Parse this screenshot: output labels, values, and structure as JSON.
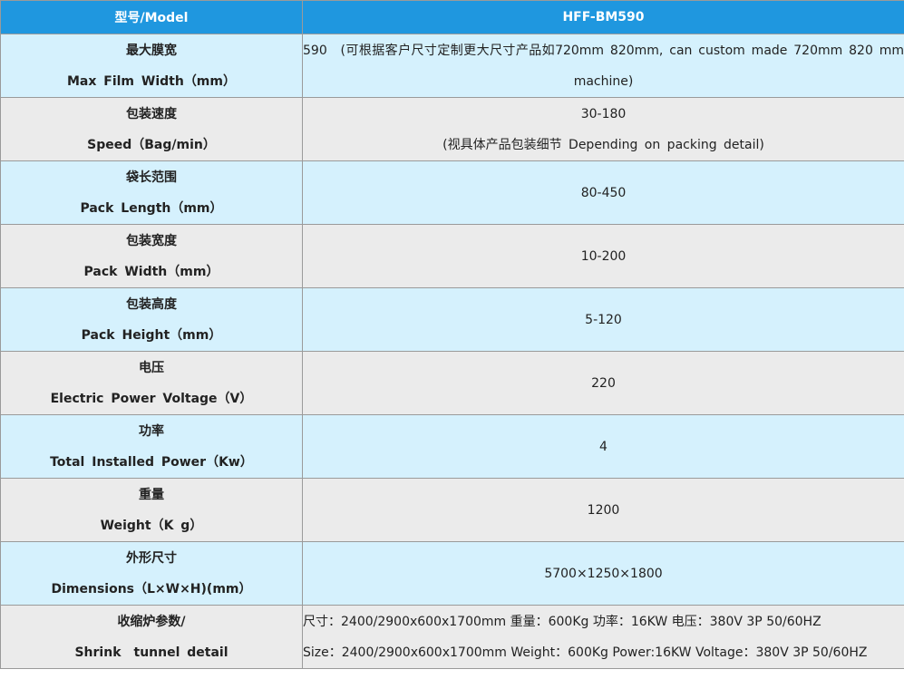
{
  "header": {
    "label": "型号/Model",
    "value": "HFF-BM590"
  },
  "rows": [
    {
      "label_cn": "最大膜宽",
      "label_en": "Max Film Width（mm）",
      "value_1": "590　(可根据客户尺寸定制更大尺寸产品如720mm 820mm, can custom made 720mm 820 mm machine)"
    },
    {
      "label_cn": "包装速度",
      "label_en": "Speed（Bag/min）",
      "value_1": "30-180",
      "value_2": "(视具体产品包装细节 Depending on packing detail)"
    },
    {
      "label_cn": "袋长范围",
      "label_en": "Pack Length（mm）",
      "value_1": "80-450"
    },
    {
      "label_cn": "包装宽度",
      "label_en": "Pack Width（mm）",
      "value_1": "10-200"
    },
    {
      "label_cn": "包装高度",
      "label_en": "Pack Height（mm）",
      "value_1": "5-120"
    },
    {
      "label_cn": "电压",
      "label_en": "Electric Power Voltage（V）",
      "value_1": "220"
    },
    {
      "label_cn": "功率",
      "label_en": "Total Installed Power（Kw）",
      "value_1": "4"
    },
    {
      "label_cn": "重量",
      "label_en": "Weight（K g）",
      "value_1": "1200"
    },
    {
      "label_cn": "外形尺寸",
      "label_en": "Dimensions（L×W×H)(mm）",
      "value_1": "5700×1250×1800"
    },
    {
      "label_cn": "收缩炉参数/",
      "label_en": "Shrink　tunnel detail",
      "value_1": "尺寸：2400/2900x600x1700mm 重量：600Kg 功率：16KW 电压：380V 3P 50/60HZ",
      "value_2": "Size：2400/2900x600x1700mm Weight：600Kg Power:16KW Voltage：380V 3P 50/60HZ"
    }
  ],
  "colors": {
    "header_bg": "#1f97df",
    "row_blue": "#d5f1fd",
    "row_gray": "#ebebeb",
    "border": "#9a9a9a"
  }
}
